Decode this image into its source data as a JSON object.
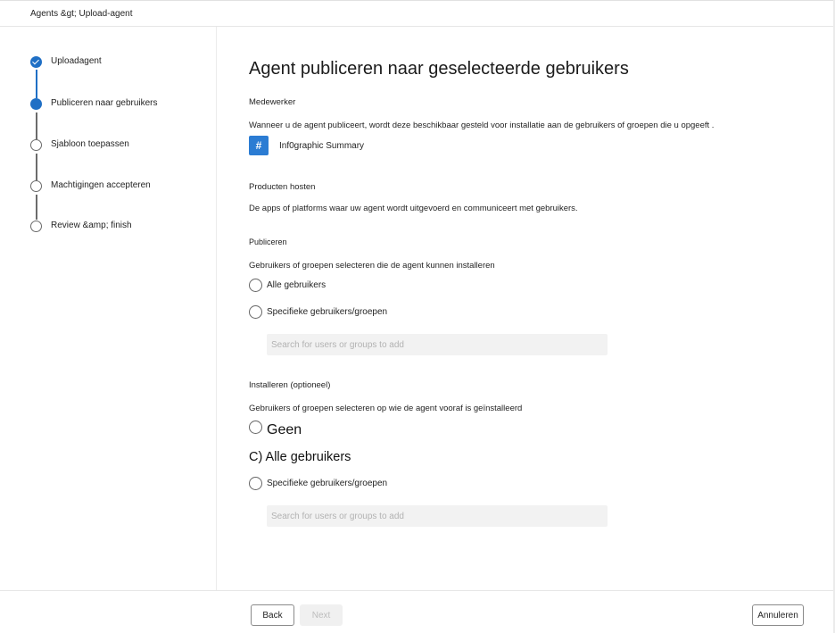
{
  "header": {
    "breadcrumb": "Agents &gt; Upload-agent"
  },
  "steps": [
    {
      "label": "Uploadagent",
      "state": "done"
    },
    {
      "label": "Publiceren naar gebruikers",
      "state": "current"
    },
    {
      "label": "Sjabloon toepassen",
      "state": "todo"
    },
    {
      "label": "Machtigingen accepteren",
      "state": "todo"
    },
    {
      "label": "Review &amp; finish",
      "state": "todo"
    }
  ],
  "main": {
    "title": "Agent publiceren naar geselecteerde gebruikers",
    "coworker_label": "Medewerker",
    "coworker_desc": "Wanneer u de agent publiceert, wordt deze beschikbaar gesteld voor installatie aan de gebruikers of groepen die u opgeeft .",
    "app": {
      "icon": "#",
      "name": "Inf0graphic Summary"
    },
    "hosts_label": "Producten hosten",
    "hosts_desc": "De apps of platforms waar uw agent wordt uitgevoerd en communiceert met gebruikers.",
    "publish": {
      "label": "Publiceren",
      "desc": "Gebruikers of groepen selecteren die de agent kunnen installeren",
      "options": [
        "Alle gebruikers",
        "Specifieke gebruikers/groepen"
      ],
      "search_placeholder": "Search for users or groups to add"
    },
    "install": {
      "label": "Installeren (optioneel)",
      "desc": "Gebruikers of groepen selecteren op wie de agent vooraf is geïnstalleerd",
      "option_none": "Geen",
      "option_all": "C) Alle gebruikers",
      "option_specific": "Specifieke gebruikers/groepen",
      "search_placeholder": "Search for users or groups to add"
    }
  },
  "footer": {
    "back": "Back",
    "next": "Next",
    "cancel": "Annuleren"
  },
  "colors": {
    "accent": "#1f6fc5",
    "app_icon": "#2b7cd3"
  }
}
